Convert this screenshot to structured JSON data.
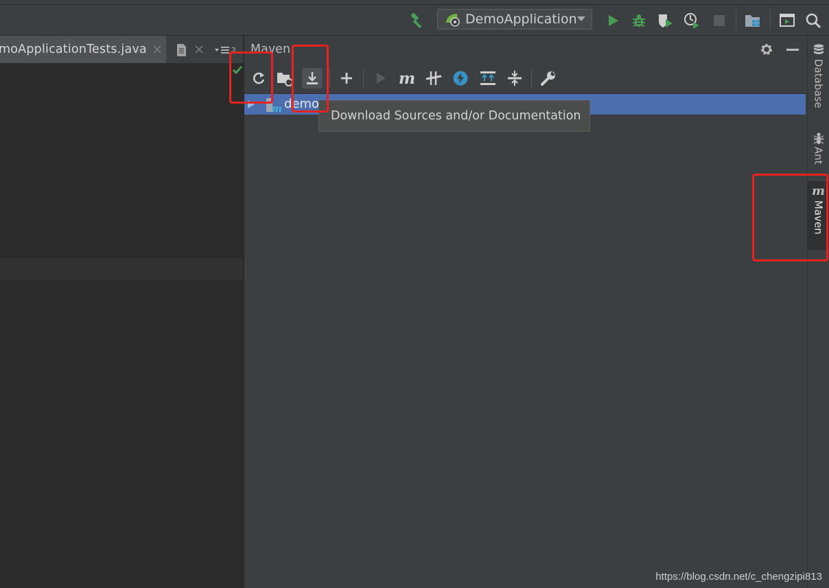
{
  "toolbar": {
    "run_config": "DemoApplication",
    "icons": [
      "hammer-icon",
      "spring-boot-icon",
      "chevron-down-icon",
      "run-icon",
      "debug-icon",
      "coverage-icon",
      "profile-icon",
      "stop-icon",
      "project-structure-icon",
      "presentation-icon",
      "search-icon"
    ]
  },
  "editor": {
    "tab_label": "moApplicationTests.java",
    "tab_overflow_count": "2"
  },
  "maven_panel": {
    "title": "Maven",
    "toolbar_icons": [
      "reload-icon",
      "folder-icon",
      "download-icon",
      "add-icon",
      "run-icon",
      "maven-goal-icon",
      "toggle-offline-icon",
      "skip-tests-icon",
      "expand-all-icon",
      "collapse-all-icon",
      "settings-icon"
    ],
    "tree": [
      {
        "label": "demo",
        "selected": true
      }
    ],
    "tooltip": "Download Sources and/or Documentation"
  },
  "right_stripe": {
    "items": [
      {
        "label": "Database",
        "icon": "database-icon"
      },
      {
        "label": "Ant",
        "icon": "ant-icon"
      },
      {
        "label": "Maven",
        "icon": "maven-icon",
        "active": true
      }
    ]
  },
  "watermark": "https://blog.csdn.net/c_chengzipi813",
  "colors": {
    "accent_selection": "#4b6eaf",
    "annotation_red": "#e8231f",
    "run_green": "#499c54",
    "tool_blue": "#3592c4"
  }
}
